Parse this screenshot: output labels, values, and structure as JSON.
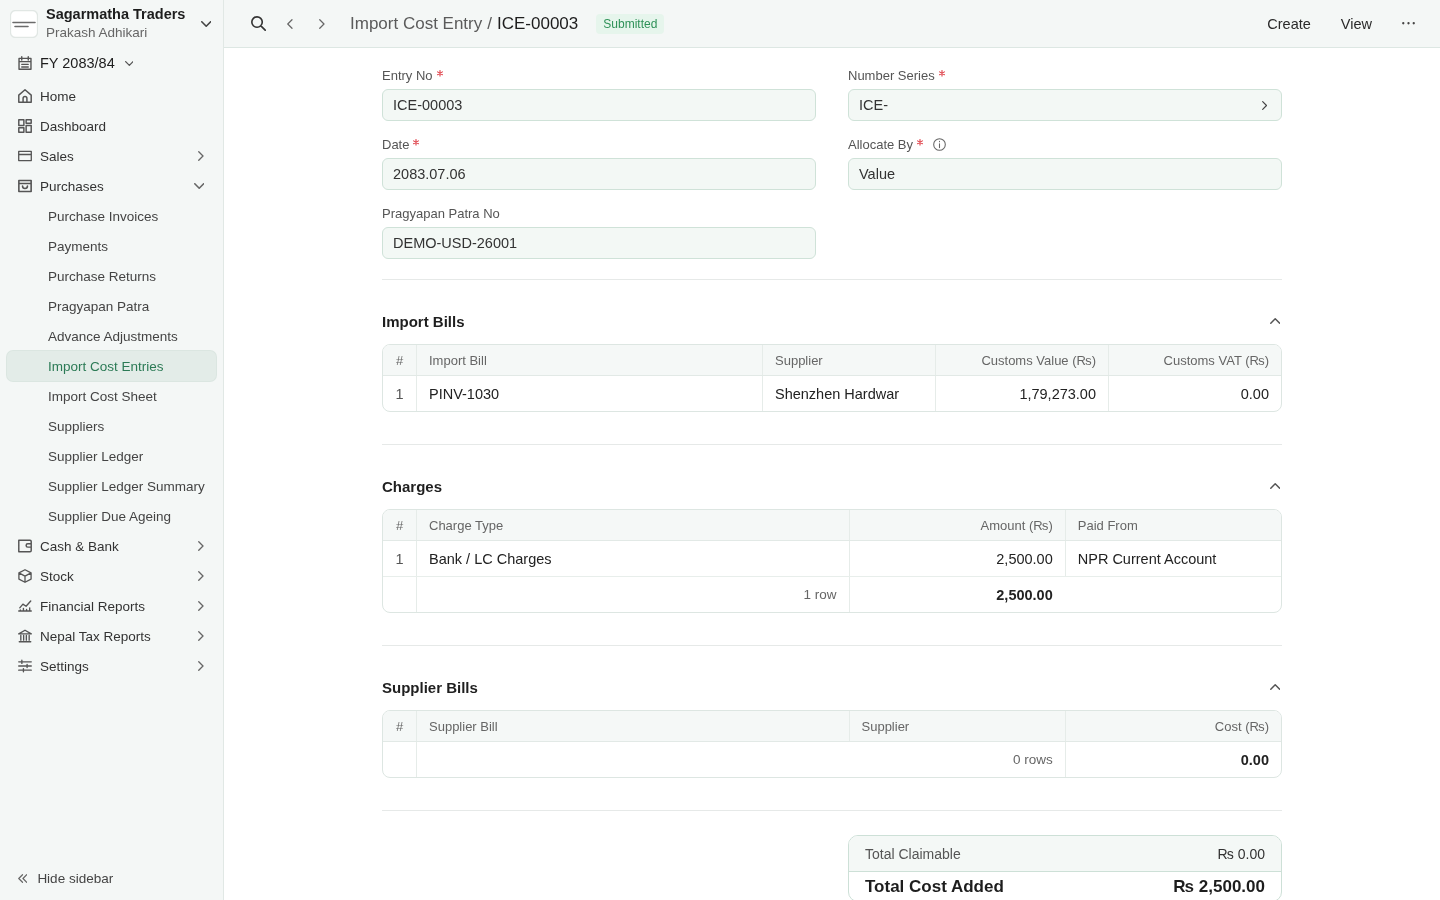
{
  "sidebar": {
    "company": {
      "name": "Sagarmatha Traders",
      "user": "Prakash Adhikari"
    },
    "fiscal_year": "FY 2083/84",
    "items": [
      {
        "label": "Home",
        "selected": false
      },
      {
        "label": "Dashboard",
        "selected": false
      },
      {
        "label": "Sales",
        "selected": false,
        "expanded": false
      },
      {
        "label": "Purchases",
        "selected": false,
        "expanded": true,
        "children": [
          {
            "label": "Purchase Invoices",
            "selected": false
          },
          {
            "label": "Payments",
            "selected": false
          },
          {
            "label": "Purchase Returns",
            "selected": false
          },
          {
            "label": "Pragyapan Patra",
            "selected": false
          },
          {
            "label": "Advance Adjustments",
            "selected": false
          },
          {
            "label": "Import Cost Entries",
            "selected": true
          },
          {
            "label": "Import Cost Sheet",
            "selected": false
          },
          {
            "label": "Suppliers",
            "selected": false
          },
          {
            "label": "Supplier Ledger",
            "selected": false
          },
          {
            "label": "Supplier Ledger Summary",
            "selected": false
          },
          {
            "label": "Supplier Due Ageing",
            "selected": false
          }
        ]
      },
      {
        "label": "Cash & Bank",
        "selected": false,
        "expanded": false
      },
      {
        "label": "Stock",
        "selected": false,
        "expanded": false
      },
      {
        "label": "Financial Reports",
        "selected": false,
        "expanded": false
      },
      {
        "label": "Nepal Tax Reports",
        "selected": false,
        "expanded": false
      },
      {
        "label": "Settings",
        "selected": false,
        "expanded": false
      }
    ],
    "footer_action": "Hide sidebar"
  },
  "topbar": {
    "breadcrumb": {
      "parent": "Import Cost Entry",
      "separator": "/",
      "current": "ICE-00003"
    },
    "status": "Submitted",
    "actions": [
      "Create",
      "View"
    ]
  },
  "form": {
    "fields": [
      {
        "label": "Entry No",
        "required": true,
        "info": false,
        "kind": "text",
        "value": "ICE-00003"
      },
      {
        "label": "Number Series",
        "required": true,
        "info": false,
        "kind": "link",
        "value": "ICE-"
      },
      {
        "label": "Date",
        "required": true,
        "info": false,
        "kind": "text",
        "value": "2083.07.06"
      },
      {
        "label": "Allocate By",
        "required": true,
        "info": true,
        "kind": "text",
        "value": "Value"
      },
      {
        "label": "Pragyapan Patra No",
        "required": false,
        "info": false,
        "kind": "text",
        "value": "DEMO-USD-26001"
      }
    ]
  },
  "sections": [
    {
      "title": "Import Bills",
      "expanded": true,
      "table": {
        "columns": [
          {
            "label": "#",
            "kind": "index"
          },
          {
            "label": "Import Bill",
            "kind": "text"
          },
          {
            "label": "Supplier",
            "kind": "text"
          },
          {
            "label": "Customs Value (₨)",
            "kind": "amount"
          },
          {
            "label": "Customs VAT (₨)",
            "kind": "amount"
          }
        ],
        "rows": [
          [
            "1",
            "PINV-1030",
            "Shenzhen Hardwar",
            "1,79,273.00",
            "0.00"
          ]
        ]
      }
    },
    {
      "title": "Charges",
      "expanded": true,
      "table": {
        "columns": [
          {
            "label": "#",
            "kind": "index",
            "totaled": false
          },
          {
            "label": "Charge Type",
            "kind": "text",
            "totaled": false
          },
          {
            "label": "Amount (₨)",
            "kind": "amount",
            "totaled": true
          },
          {
            "label": "Paid From",
            "kind": "text",
            "totaled": false
          }
        ],
        "rows": [
          [
            "1",
            "Bank / LC Charges",
            "2,500.00",
            "NPR Current Account"
          ]
        ],
        "footer": {
          "count": "1 row",
          "total": "2,500.00"
        }
      }
    },
    {
      "title": "Supplier Bills",
      "expanded": true,
      "table": {
        "columns": [
          {
            "label": "#",
            "kind": "index",
            "totaled": false
          },
          {
            "label": "Supplier Bill",
            "kind": "text",
            "totaled": false
          },
          {
            "label": "Supplier",
            "kind": "text",
            "totaled": false
          },
          {
            "label": "Cost (₨)",
            "kind": "amount",
            "totaled": true
          }
        ],
        "footer": {
          "count": "0 rows",
          "total": "0.00"
        }
      }
    }
  ],
  "summary": {
    "rows": [
      {
        "label": "Total Claimable",
        "value": "₨ 0.00",
        "kind": "line"
      },
      {
        "label": "Total Cost Added",
        "value": "₨ 2,500.00",
        "kind": "grand_total"
      }
    ]
  }
}
